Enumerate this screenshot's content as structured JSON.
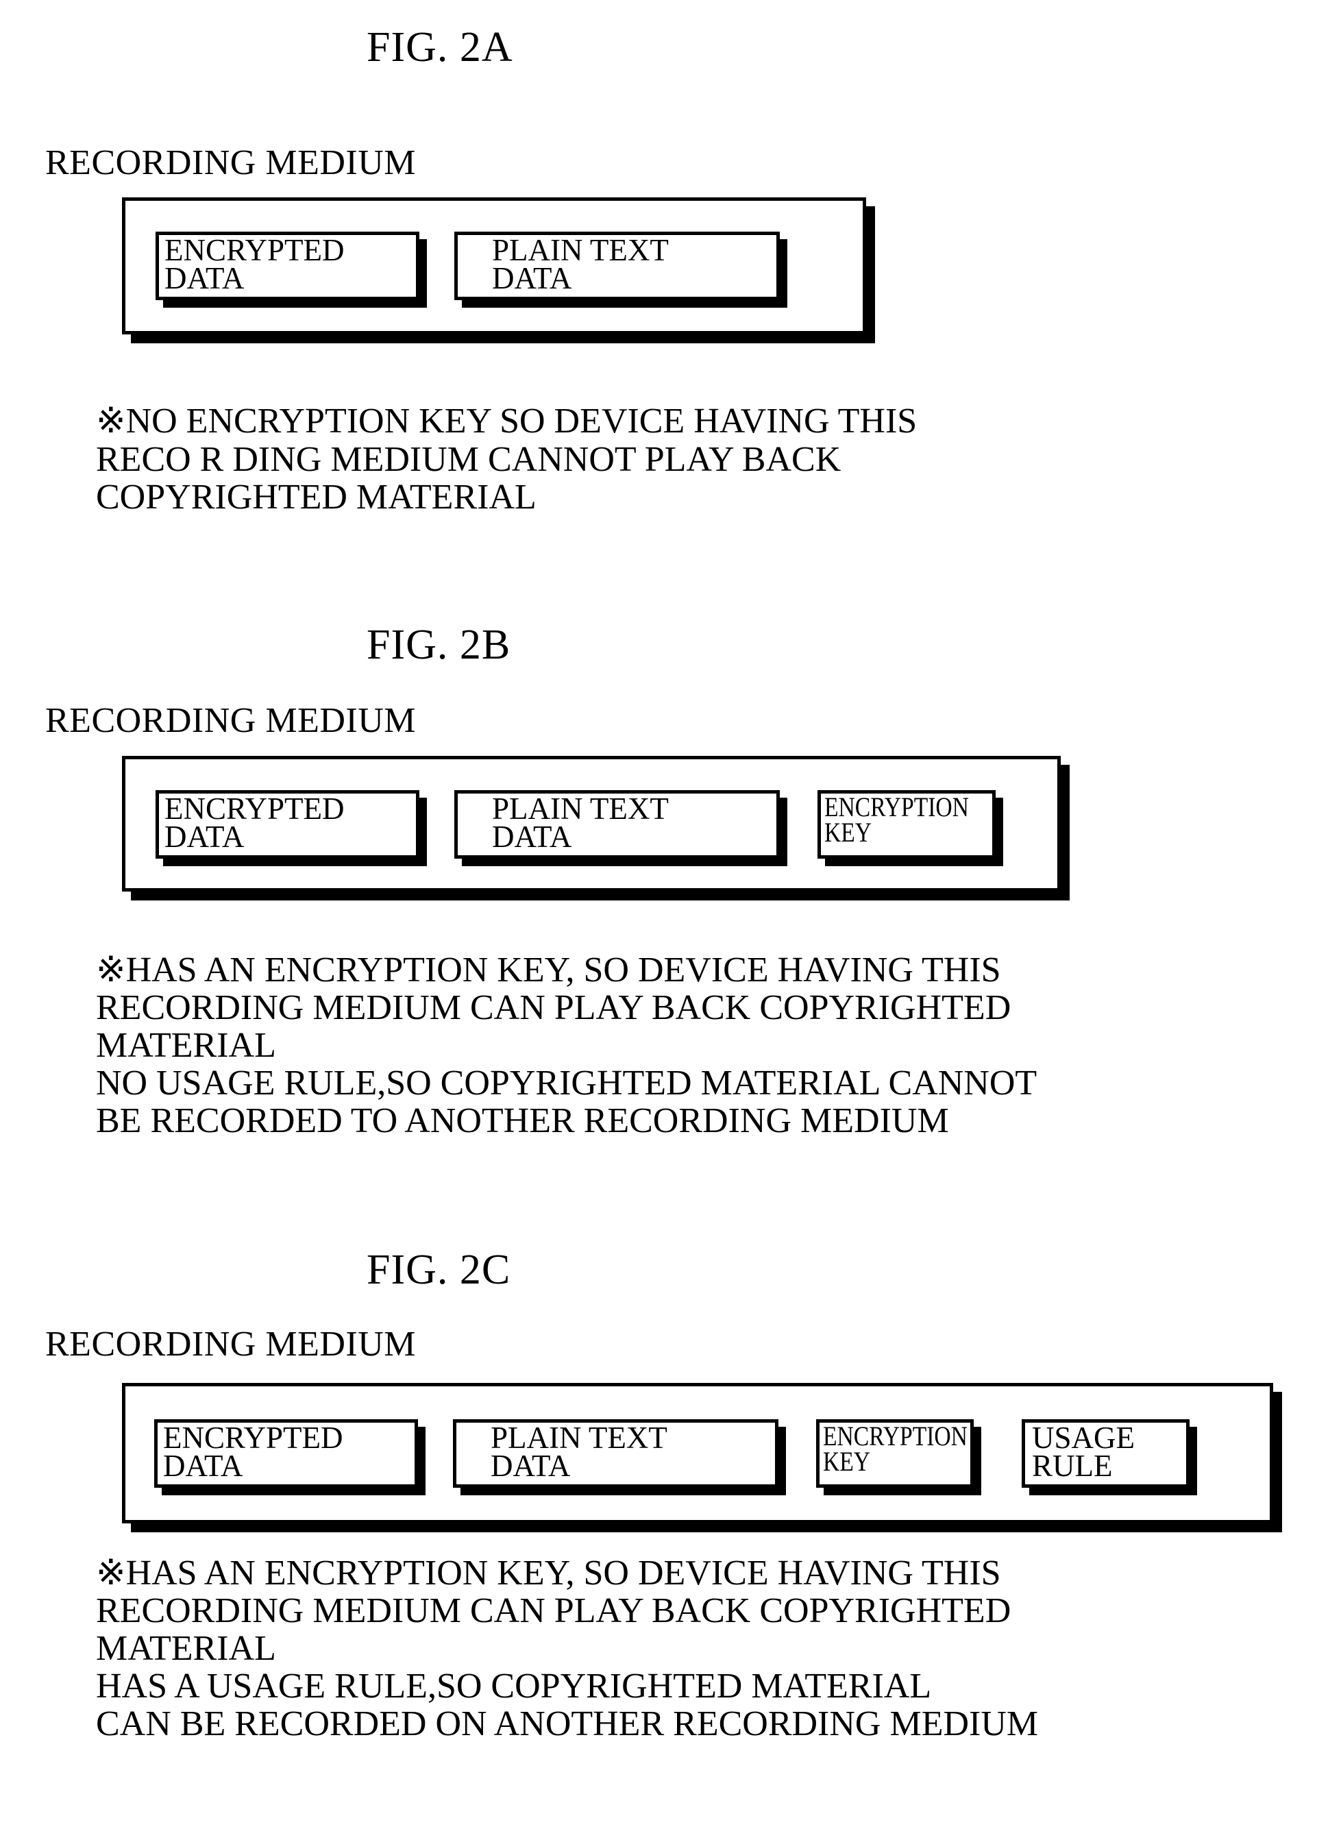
{
  "document": {
    "type": "patent-figure-sheet",
    "figures": [
      {
        "id": "fig-2a",
        "title": "FIG. 2A",
        "medium_label": "RECORDING MEDIUM",
        "blocks": [
          {
            "label": "ENCRYPTED\nDATA",
            "name": "encrypted-data-block"
          },
          {
            "label": "PLAIN TEXT\nDATA",
            "name": "plain-text-data-block"
          }
        ],
        "note": "※NO ENCRYPTION KEY SO DEVICE HAVING THIS\nRECO R DING MEDIUM CANNOT PLAY BACK\n COPYRIGHTED MATERIAL"
      },
      {
        "id": "fig-2b",
        "title": "FIG. 2B",
        "medium_label": "RECORDING MEDIUM",
        "blocks": [
          {
            "label": "ENCRYPTED\nDATA",
            "name": "encrypted-data-block"
          },
          {
            "label": "PLAIN TEXT\nDATA",
            "name": "plain-text-data-block"
          },
          {
            "label": "ENCRYPTION\nKEY",
            "name": "encryption-key-block"
          }
        ],
        "note": "※HAS AN ENCRYPTION KEY, SO DEVICE HAVING THIS\nRECORDING MEDIUM CAN PLAY BACK COPYRIGHTED\nMATERIAL\nNO USAGE RULE,SO COPYRIGHTED MATERIAL CANNOT\nBE RECORDED TO ANOTHER RECORDING MEDIUM"
      },
      {
        "id": "fig-2c",
        "title": "FIG. 2C",
        "medium_label": "RECORDING MEDIUM",
        "blocks": [
          {
            "label": "ENCRYPTED\nDATA",
            "name": "encrypted-data-block"
          },
          {
            "label": "PLAIN TEXT\nDATA",
            "name": "plain-text-data-block"
          },
          {
            "label": "ENCRYPTION\nKEY",
            "name": "encryption-key-block"
          },
          {
            "label": "USAGE\nRULE",
            "name": "usage-rule-block"
          }
        ],
        "note": "※HAS AN ENCRYPTION KEY, SO DEVICE HAVING THIS\nRECORDING MEDIUM CAN PLAY BACK COPYRIGHTED\nMATERIAL\n    HAS A USAGE RULE,SO COPYRIGHTED MATERIAL\nCAN BE RECORDED ON ANOTHER RECORDING MEDIUM"
      }
    ],
    "colors": {
      "ink": "#000000",
      "paper": "#ffffff"
    }
  }
}
